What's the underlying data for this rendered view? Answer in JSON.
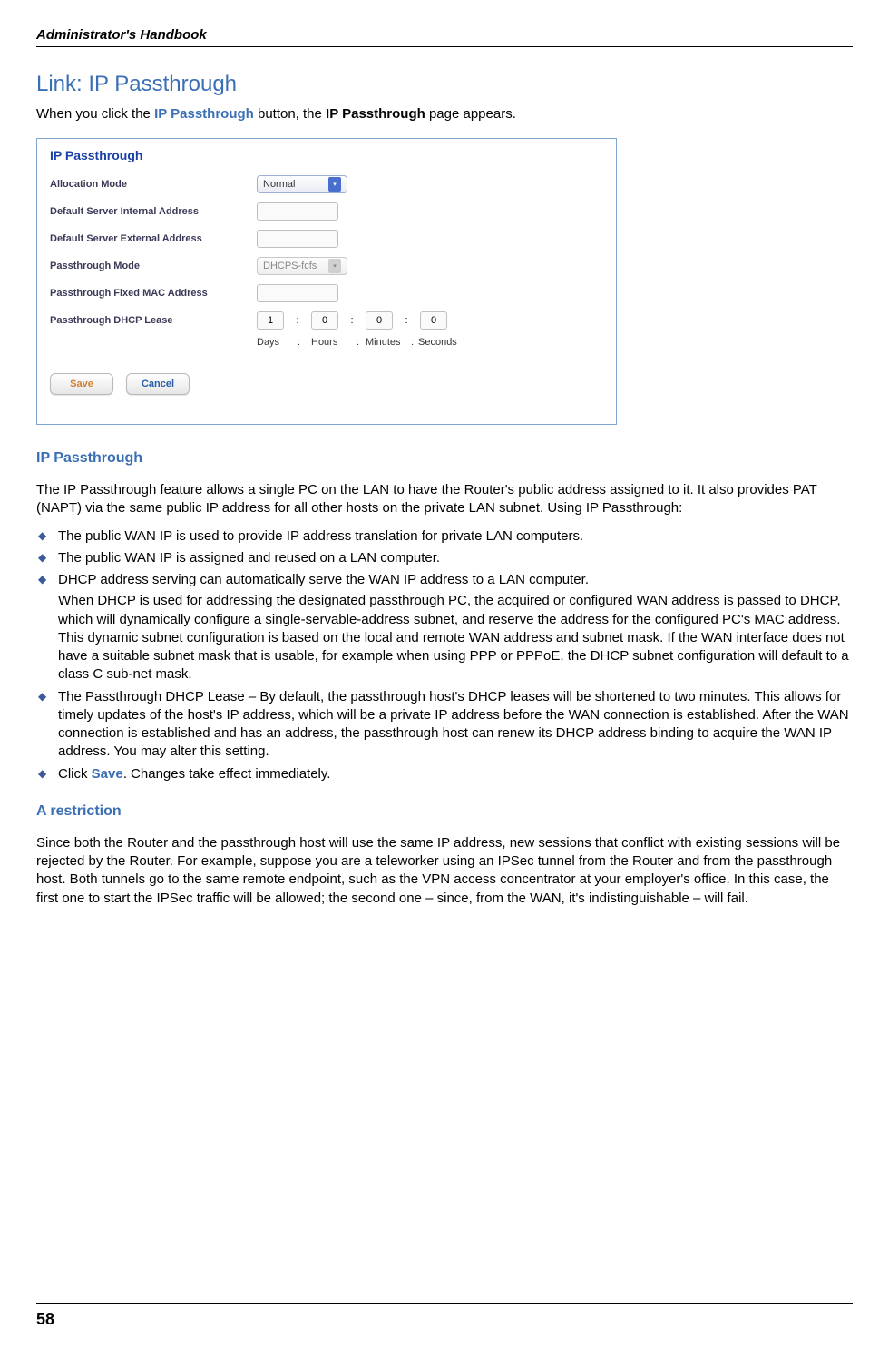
{
  "header": {
    "book_title": "Administrator's Handbook"
  },
  "section": {
    "title": "Link: IP Passthrough",
    "intro_prefix": "When you click the ",
    "intro_button": "IP Passthrough",
    "intro_mid": " button, the ",
    "intro_page": "IP Passthrough",
    "intro_suffix": " page appears."
  },
  "screenshot": {
    "title": "IP Passthrough",
    "labels": {
      "alloc": "Allocation Mode",
      "def_int": "Default Server Internal Address",
      "def_ext": "Default Server External Address",
      "pmode": "Passthrough Mode",
      "pmac": "Passthrough Fixed MAC Address",
      "please": "Passthrough DHCP Lease"
    },
    "values": {
      "alloc": "Normal",
      "pmode": "DHCPS-fcfs",
      "days": "1",
      "hours": "0",
      "minutes": "0",
      "seconds": "0"
    },
    "captions": {
      "days": "Days",
      "hours": "Hours",
      "minutes": "Minutes",
      "seconds": "Seconds",
      "sep": ":"
    },
    "buttons": {
      "save": "Save",
      "cancel": "Cancel"
    }
  },
  "content": {
    "heading1": "IP Passthrough",
    "para1": "The IP Passthrough feature allows a single PC on the LAN to have the Router's public address assigned to it. It also provides PAT (NAPT) via the same public IP address for all other hosts on the private LAN subnet. Using IP Passthrough:",
    "bullets": {
      "b1": "The public WAN IP is used to provide IP address translation for private LAN computers.",
      "b2": "The public WAN IP is assigned and reused on a LAN computer.",
      "b3": "DHCP address serving can automatically serve the WAN IP address to a LAN computer.",
      "b3_cont": "When DHCP is used for addressing the designated passthrough PC, the acquired or configured WAN address is passed to DHCP, which will dynamically configure a single-servable-address subnet, and reserve the address for the configured PC's MAC address. This dynamic subnet configuration is based on the local and remote WAN address and subnet mask. If the WAN interface does not have a suitable subnet mask that is usable, for example when using PPP or PPPoE, the DHCP subnet configuration will default to a class C sub-net mask.",
      "b4": "The Passthrough DHCP Lease – By default, the passthrough host's DHCP leases will be shortened to two minutes. This allows for timely updates of the host's IP address, which will be a private IP address before the WAN connection is established. After the WAN connection is established and has an address, the passthrough host can renew its DHCP address binding to acquire the WAN IP address. You may alter this setting.",
      "b5_prefix": "Click ",
      "b5_link": "Save",
      "b5_suffix": ". Changes take effect immediately."
    },
    "heading2": "A restriction",
    "para2": "Since both the Router and the passthrough host will use the same IP address, new sessions that conflict with existing sessions will be rejected by the Router. For example, suppose you are a teleworker using an IPSec tunnel from the Router and from the passthrough host. Both tunnels go to the same remote endpoint, such as the VPN access concentrator at your employer's office. In this case, the first one to start the IPSec traffic will be allowed; the second one – since, from the WAN, it's indistinguishable – will fail."
  },
  "footer": {
    "page_number": "58"
  }
}
